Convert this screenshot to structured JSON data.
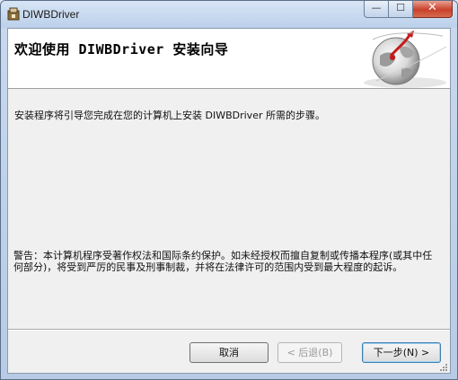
{
  "window": {
    "title": "DIWBDriver"
  },
  "caption_buttons": {
    "minimize_glyph": "—",
    "maximize_glyph": "☐",
    "close_glyph": "✕"
  },
  "banner": {
    "title": "欢迎使用 DIWBDriver 安装向导"
  },
  "body": {
    "intro": "安装程序将引导您完成在您的计算机上安装 DIWBDriver 所需的步骤。",
    "warning": "警告：本计算机程序受著作权法和国际条约保护。如未经授权而擅自复制或传播本程序(或其中任何部分)，将受到严厉的民事及刑事制裁，并将在法律许可的范围内受到最大程度的起诉。"
  },
  "buttons": {
    "cancel": "取消",
    "back": "< 后退(B)",
    "next": "下一步(N) >"
  },
  "colors": {
    "titlebar": "#bcd0ea",
    "close_button": "#c8412b",
    "dialog_bg": "#f0f0f0"
  }
}
